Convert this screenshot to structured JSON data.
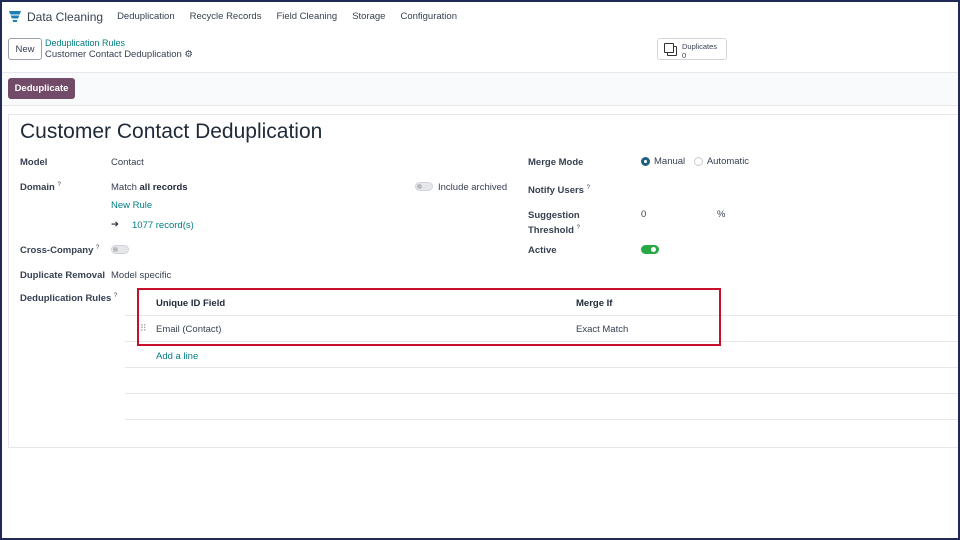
{
  "nav": {
    "app": "Data Cleaning",
    "items": [
      "Deduplication",
      "Recycle Records",
      "Field Cleaning",
      "Storage",
      "Configuration"
    ]
  },
  "control": {
    "new": "New",
    "breadcrumb_parent": "Deduplication Rules",
    "breadcrumb_current": "Customer Contact Deduplication",
    "duplicates_label": "Duplicates",
    "duplicates_count": "0",
    "deduplicate": "Deduplicate"
  },
  "form": {
    "title": "Customer Contact Deduplication",
    "model_label": "Model",
    "model": "Contact",
    "domain_label": "Domain",
    "domain_prefix": "Match ",
    "domain_bold": "all records",
    "include_archived": "Include archived",
    "new_rule": "New Rule",
    "records": "1077 record(s)",
    "cross_company_label": "Cross-Company",
    "dup_removal_label": "Duplicate Removal",
    "dup_removal": "Model specific",
    "rules_label": "Deduplication Rules",
    "merge_mode_label": "Merge Mode",
    "merge_manual": "Manual",
    "merge_auto": "Automatic",
    "notify_label": "Notify Users",
    "threshold_label1": "Suggestion",
    "threshold_label2": "Threshold",
    "threshold": "0",
    "percent": "%",
    "active_label": "Active",
    "help": "?"
  },
  "table": {
    "col1": "Unique ID Field",
    "col2": "Merge If",
    "rows": [
      {
        "field": "Email (Contact)",
        "merge": "Exact Match"
      }
    ],
    "add_line": "Add a line"
  }
}
